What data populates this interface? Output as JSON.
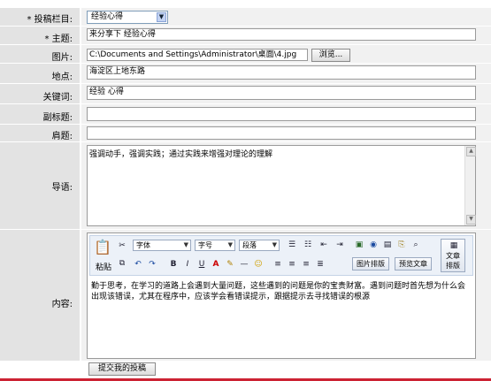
{
  "form": {
    "column": {
      "label": "* 投稿栏目:",
      "value": "经验心得"
    },
    "subject": {
      "label": "* 主题:",
      "value": "来分享下 经验心得"
    },
    "image": {
      "label": "图片:",
      "value": "C:\\Documents and Settings\\Administrator\\桌面\\4.jpg",
      "browse": "浏览..."
    },
    "location": {
      "label": "地点:",
      "value": "海淀区上地东路"
    },
    "keywords": {
      "label": "关键词:",
      "value": "经验 心得"
    },
    "subtitle": {
      "label": "副标题:",
      "value": ""
    },
    "eyebrow": {
      "label": "肩题:",
      "value": ""
    },
    "lead": {
      "label": "导语:",
      "value": "强调动手，强调实践；通过实践来增强对理论的理解"
    },
    "content": {
      "label": "内容:",
      "value": "勤于思考，在学习的道路上会遇到大量问题，这些遇到的问题是你的宝贵财富。遇到问题时首先想为什么会出现该错误，尤其在程序中，应该学会看错误提示，跟据提示去寻找错误的根源"
    },
    "submit": "提交我的投稿"
  },
  "toolbar": {
    "paste": "粘贴",
    "font": "字体",
    "size": "字号",
    "paragraph": "段落",
    "image_layout": "图片排版",
    "preview": "预览文章",
    "article_layout_1": "文章",
    "article_layout_2": "排版"
  }
}
